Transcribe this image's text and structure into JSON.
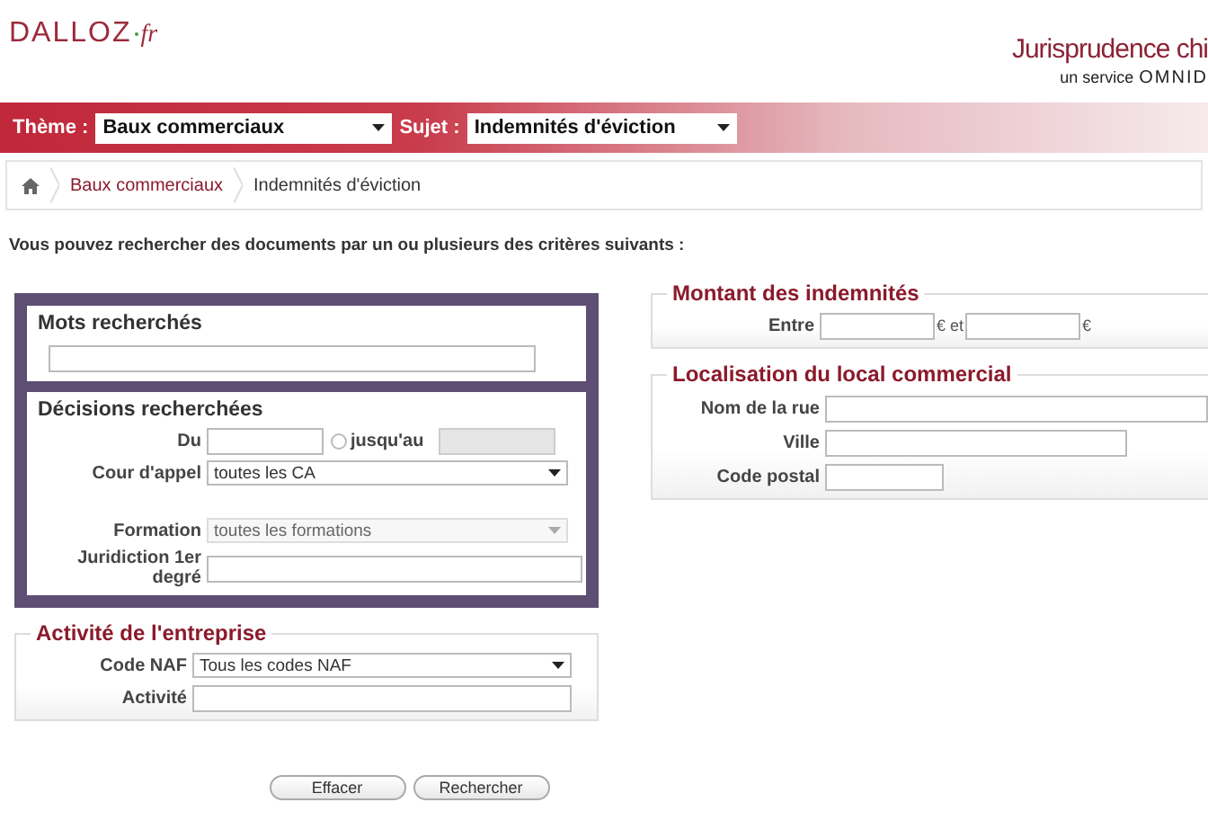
{
  "header": {
    "logo": "DALLOZ",
    "logo_suffix": "fr",
    "site_title": "Jurisprudence chi",
    "service_label": "un service",
    "service_brand": "OMNID"
  },
  "filter_bar": [
    {
      "label": "Thème :",
      "value": "Baux commerciaux"
    },
    {
      "label": "Sujet :",
      "value": "Indemnités d'éviction"
    }
  ],
  "breadcrumb": [
    {
      "label": "Baux commerciaux",
      "kind": "link"
    },
    {
      "label": "Indemnités d'éviction",
      "kind": "current"
    }
  ],
  "intro": "Vous pouvez rechercher des documents par un ou plusieurs des critères suivants :",
  "mots": {
    "title": "Mots recherchés"
  },
  "decisions": {
    "title": "Décisions recherchées",
    "fields": [
      {
        "kind": "daterange",
        "label": "Du",
        "option_label": "jusqu'au",
        "checked": false,
        "disabled": true
      },
      {
        "kind": "select",
        "label": "Cour d'appel",
        "value": "toutes les CA",
        "disabled": false
      },
      {
        "kind": "spacer"
      },
      {
        "kind": "select",
        "label": "Formation",
        "value": "toutes les formations",
        "disabled": true
      },
      {
        "kind": "text",
        "label": "Juridiction 1er degré"
      }
    ]
  },
  "activite": {
    "title": "Activité de l'entreprise",
    "fields": [
      {
        "kind": "select",
        "label": "Code NAF",
        "value": "Tous les codes NAF",
        "disabled": false
      },
      {
        "kind": "text",
        "label": "Activité"
      }
    ]
  },
  "montant": {
    "title": "Montant des indemnités",
    "label": "Entre",
    "unit_1": "€ et",
    "unit_2": "€"
  },
  "localisation": {
    "title": "Localisation du local commercial",
    "fields": [
      {
        "kind": "text",
        "label": "Nom de la rue"
      },
      {
        "kind": "text",
        "label": "Ville"
      },
      {
        "kind": "text",
        "label": "Code postal"
      }
    ]
  },
  "buttons": [
    "Effacer",
    "Rechercher"
  ]
}
